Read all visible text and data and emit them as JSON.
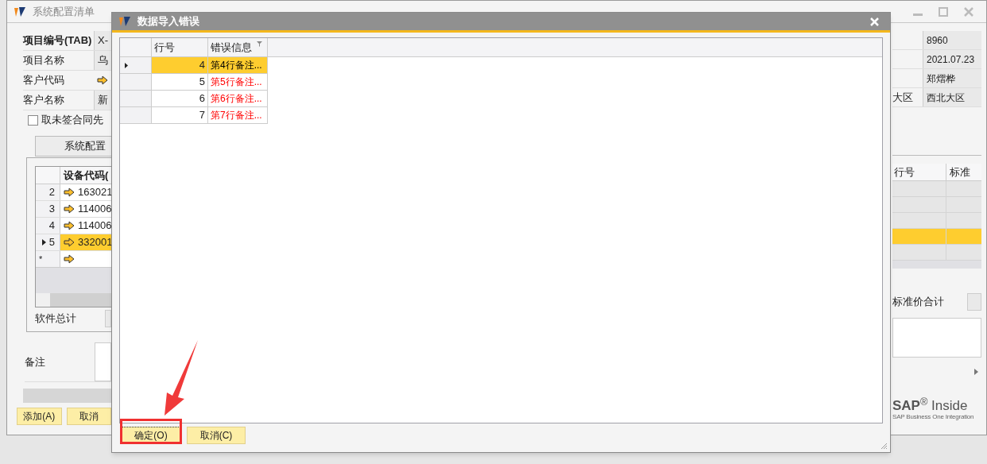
{
  "window": {
    "title": "系统配置清单"
  },
  "form_left": [
    {
      "label": "项目编号(TAB)",
      "value": "X-",
      "emphasized": true,
      "kind": "text"
    },
    {
      "label": "项目名称",
      "value": "乌",
      "emphasized": false,
      "kind": "text"
    },
    {
      "label": "客户代码",
      "emphasized": false,
      "kind": "link"
    },
    {
      "label": "客户名称",
      "value": "新",
      "emphasized": false,
      "kind": "text"
    }
  ],
  "checkbox": {
    "label": "取未签合同先",
    "checked": false
  },
  "tab": {
    "label": "系统配置"
  },
  "grid": {
    "columns": [
      "设备代码("
    ],
    "rows": [
      {
        "row_number": "2",
        "value": "163021",
        "selected": false
      },
      {
        "row_number": "3",
        "value": "114006",
        "selected": false
      },
      {
        "row_number": "4",
        "value": "114006",
        "selected": false
      },
      {
        "row_number": "5",
        "value": "332001",
        "selected": true
      }
    ],
    "new_row_marker": "*"
  },
  "software_total_label": "软件总计",
  "remarks_label": "备注",
  "buttons": [
    "添加(A)",
    "取消"
  ],
  "form_right": [
    {
      "value": "8960"
    },
    {
      "value": "2021.07.23"
    },
    {
      "value": "郑熠桦"
    },
    {
      "label": "大区",
      "value": "西北大区"
    }
  ],
  "right_grid": {
    "columns": [
      "行号",
      "标准"
    ],
    "rows": [
      {
        "selected": false
      },
      {
        "selected": false
      },
      {
        "selected": false
      },
      {
        "selected": true
      },
      {
        "selected": false
      }
    ]
  },
  "standard_total_label": "标准价合计",
  "branding": {
    "logo": "**SAP**$^{®}$ Inside",
    "tagline": "SAP Business One Integration"
  },
  "dialog": {
    "title": "数据导入错误",
    "columns": [
      "行号",
      "错误信息"
    ],
    "rows": [
      {
        "line": "4",
        "message": "第4行备注...",
        "selected": true
      },
      {
        "line": "5",
        "message": "第5行备注...",
        "selected": false
      },
      {
        "line": "6",
        "message": "第6行备注...",
        "selected": false
      },
      {
        "line": "7",
        "message": "第7行备注...",
        "selected": false
      }
    ],
    "buttons": [
      {
        "label": "确定(O)",
        "focused": true
      },
      {
        "label": "取消(C)",
        "focused": false
      }
    ]
  }
}
